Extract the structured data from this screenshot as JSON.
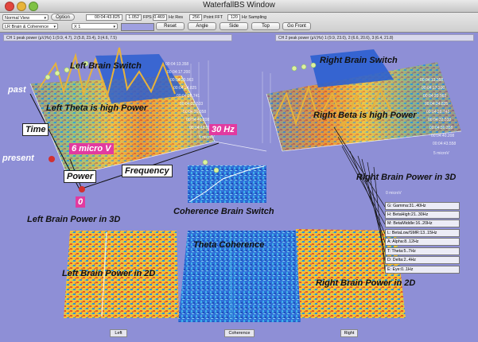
{
  "window": {
    "title": "WaterfallBS Window"
  },
  "toolbar": {
    "view_select": "Normal View",
    "option_button": "Option",
    "time_value": "00:04:43.825",
    "fps_value": "1.052",
    "fps_label": "FPS",
    "hz_res_value": "0.469",
    "hz_res_label": "Hz Res",
    "fft_value": "256",
    "fft_label": "Point FFT",
    "sampling_value": "120",
    "sampling_label": "Hz Sampling",
    "mode_select": "LR Brain & Coherence",
    "scale_select": "X 1",
    "reset_button": "Reset",
    "angle_button": "Angle",
    "side_button": "Side",
    "top_button": "Top",
    "gofront_button": "Go Front"
  },
  "channels": {
    "ch1": "CH 1 peak power (µV,Hz) 1:(9.9, 4.7), 2:(5.8, 23.4), 3:(4.6, 7.5)",
    "ch2": "CH 2 peak power (µV,Hz) 1:(9.9, 23.0), 2:(6.6, 20.6), 3:(6.4, 21.8)"
  },
  "annotations": {
    "left_brain_switch": "Left Brain Switch",
    "right_brain_switch": "Right Brain Switch",
    "past": "past",
    "present": "present",
    "time": "Time",
    "left_theta": "Left Theta is high Power",
    "right_beta": "Right Beta is high Power",
    "six_micro_v": "6 micro V",
    "thirty_hz": "30 Hz",
    "power": "Power",
    "frequency": "Frequency",
    "zero": "0",
    "right_power_3d": "Right Brain Power in 3D",
    "left_power_3d": "Left Brain Power in 3D",
    "coherence_switch": "Coherence Brain Switch",
    "theta_coherence": "Theta Coherence",
    "left_power_2d": "Left Brain Power in 2D",
    "right_power_2d": "Right Brain Power in 2D"
  },
  "time_labels_left": [
    "00:04:13.358",
    "00:04:17.200",
    "00:04:20.963",
    "00:04:24.825",
    "00:04:28.741",
    "00:04:32.533",
    "00:04:36.358",
    "00:04:40.208",
    "00:04:43.558"
  ],
  "time_labels_right": [
    "00:04:13.358",
    "00:04:17.200",
    "00:04:20.963",
    "00:04:24.825",
    "00:04:28.741",
    "00:04:32.533",
    "00:04:36.358",
    "00:04:40.208",
    "00:04:43.558"
  ],
  "micro_labels": {
    "left_5": "5 microV",
    "right_5": "5 microV",
    "right_0": "0 microV"
  },
  "legend": [
    "G: Gamma:31..40Hz",
    "H: BetaHigh:21..30Hz",
    "M: BetaMiddle:16..20Hz",
    "L: BetaLow/SMR:13..15Hz",
    "A: Alpha:8..12Hz",
    "T: Theta:5..7Hz",
    "D: Delta:2..4Hz",
    "E: Eye:0..1Hz"
  ],
  "bottom": {
    "left": "Left",
    "coherence": "Coherence",
    "right": "Right"
  },
  "colors": {
    "background": "#8e8fd6",
    "accent_pink": "#e23aa0",
    "grid_white": "#ffffff"
  }
}
